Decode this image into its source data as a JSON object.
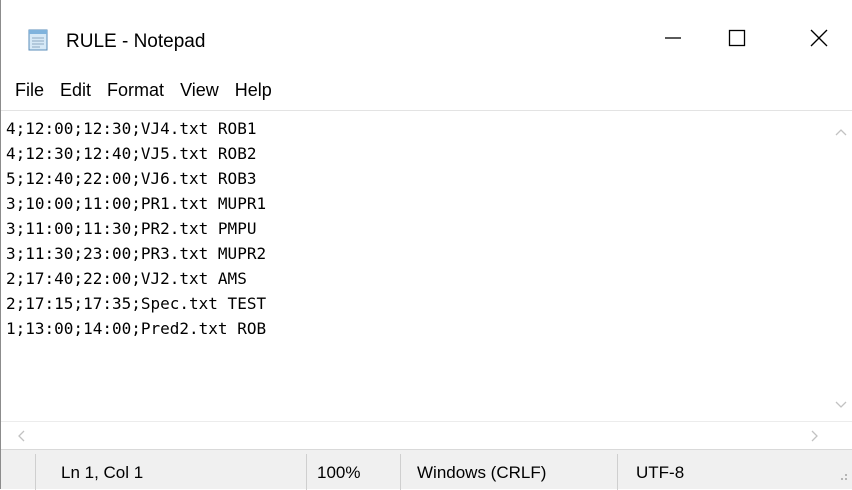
{
  "window": {
    "title": "RULE - Notepad",
    "icon": "notepad-icon",
    "controls": {
      "minimize": "minimize-icon",
      "maximize": "maximize-icon",
      "close": "close-icon"
    }
  },
  "menu": {
    "items": [
      "File",
      "Edit",
      "Format",
      "View",
      "Help"
    ]
  },
  "editor": {
    "lines": [
      "4;12:00;12:30;VJ4.txt ROB1",
      "4;12:30;12:40;VJ5.txt ROB2",
      "5;12:40;22:00;VJ6.txt ROB3",
      "3;10:00;11:00;PR1.txt MUPR1",
      "3;11:00;11:30;PR2.txt PMPU",
      "3;11:30;23:00;PR3.txt MUPR2",
      "2;17:40;22:00;VJ2.txt AMS",
      "2;17:15;17:35;Spec.txt TEST",
      "1;13:00;14:00;Pred2.txt ROB"
    ]
  },
  "status": {
    "position": "Ln 1, Col 1",
    "zoom": "100%",
    "line_ending": "Windows (CRLF)",
    "encoding": "UTF-8"
  }
}
